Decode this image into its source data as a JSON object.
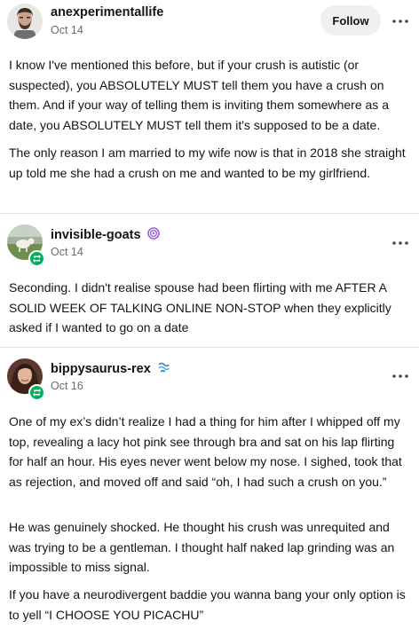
{
  "posts": [
    {
      "username": "anexperimentallife",
      "date": "Oct 14",
      "follow_label": "Follow",
      "has_follow": true,
      "paragraphs": [
        "I know I've mentioned this before, but if your crush is autistic (or suspected), you ABSOLUTELY MUST tell them you have a crush on them. And if your way of telling them is inviting them somewhere as a date, you ABSOLUTELY MUST tell them it's supposed to be a date.",
        "The only reason I am married to my wife now is that in 2018 she straight up told me she had a crush on me and wanted to be my girlfriend."
      ]
    },
    {
      "username": "invisible-goats",
      "date": "Oct 14",
      "badge_icon": "purple-spiral-badge-icon",
      "paragraphs": [
        "Seconding. I didn't realise spouse had been flirting with me AFTER A SOLID WEEK OF TALKING ONLINE NON-STOP when they explicitly asked if I wanted to go on a date"
      ]
    },
    {
      "username": "bippysaurus-rex",
      "date": "Oct 16",
      "badge_icon": "blue-wave-badge-icon",
      "paragraphs": [
        "One of my ex’s didn’t realize I had a thing for him after I whipped off my top, revealing a lacy hot pink see through bra and sat on his lap flirting for half an hour. His eyes never went below my nose. I sighed, took that as rejection, and moved off and said “oh, I had such a crush on you.”",
        "He was genuinely shocked. He thought his crush was unrequited and was trying to be a gentleman. I thought half naked lap grinding was an impossible to miss signal.",
        "If you have a neurodivergent baddie you wanna bang your only option is to yell “I CHOOSE YOU PICACHU”"
      ]
    }
  ],
  "colors": {
    "reblog_badge": "#00b15c",
    "follow_button_bg": "#f0f0f0",
    "secondary_text": "#6b6b6b",
    "divider": "#e4e4e4"
  }
}
